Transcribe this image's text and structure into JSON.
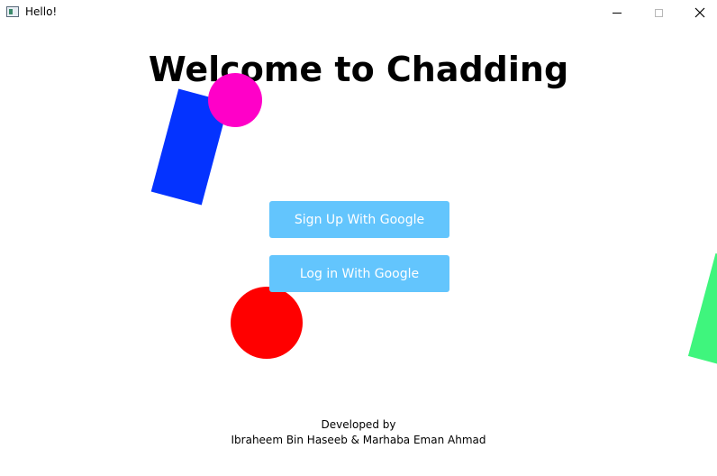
{
  "window": {
    "title": "Hello!",
    "icons": {
      "app": "app-window-icon",
      "minimize": "minimize-icon",
      "maximize": "maximize-icon",
      "close": "close-icon"
    }
  },
  "main": {
    "heading": "Welcome to Chadding",
    "signup_label": "Sign Up With Google",
    "login_label": "Log in With Google",
    "button_color": "#63c5fd",
    "button_text_color": "#ffffff"
  },
  "decorations": {
    "blue_rect_color": "#0433ff",
    "magenta_circle_color": "#ff00c8",
    "red_circle_color": "#ff0000",
    "green_shape_color": "#3ff57d"
  },
  "footer": {
    "line1": "Developed by",
    "line2": "Ibraheem Bin Haseeb & Marhaba Eman Ahmad"
  }
}
